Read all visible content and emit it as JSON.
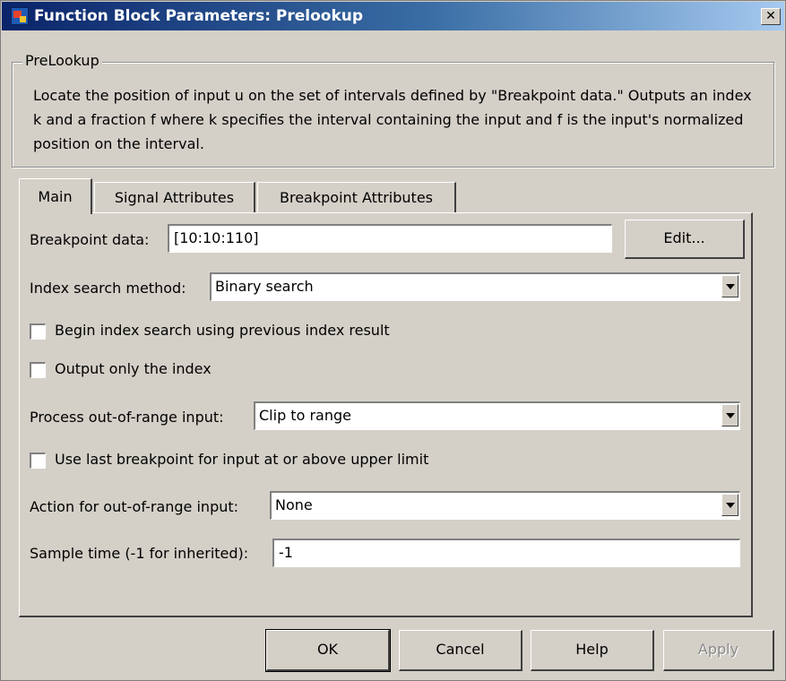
{
  "window": {
    "title": "Function Block Parameters: Prelookup",
    "close_glyph": "✕",
    "icon": "simulink-block-icon"
  },
  "description": {
    "group_label": "PreLookup",
    "text": "Locate the position of input u on the set of intervals defined by \"Breakpoint data.\" Outputs an index k and a fraction f where k specifies the interval containing the input and f is the input's normalized position on the interval."
  },
  "tabs": [
    {
      "label": "Main",
      "active": true
    },
    {
      "label": "Signal Attributes",
      "active": false
    },
    {
      "label": "Breakpoint Attributes",
      "active": false
    }
  ],
  "main": {
    "breakpoint_data": {
      "label": "Breakpoint data:",
      "value": "[10:10:110]",
      "edit_label": "Edit..."
    },
    "index_search_method": {
      "label": "Index search method:",
      "value": "Binary search"
    },
    "begin_index_search": {
      "label": "Begin index search using previous index result",
      "checked": false
    },
    "output_only_index": {
      "label": "Output only the index",
      "checked": false
    },
    "process_out_of_range": {
      "label": "Process out-of-range input:",
      "value": "Clip to range"
    },
    "use_last_breakpoint": {
      "label": "Use last breakpoint for input at or above upper limit",
      "checked": false
    },
    "action_out_of_range": {
      "label": "Action for out-of-range input:",
      "value": "None"
    },
    "sample_time": {
      "label": "Sample time (-1 for inherited):",
      "value": "-1"
    }
  },
  "buttons": {
    "ok": "OK",
    "cancel": "Cancel",
    "help": "Help",
    "apply": "Apply"
  },
  "colors": {
    "titlebar_start": "#0a246a",
    "titlebar_end": "#a6caf0",
    "window_bg": "#d4d0c8"
  }
}
